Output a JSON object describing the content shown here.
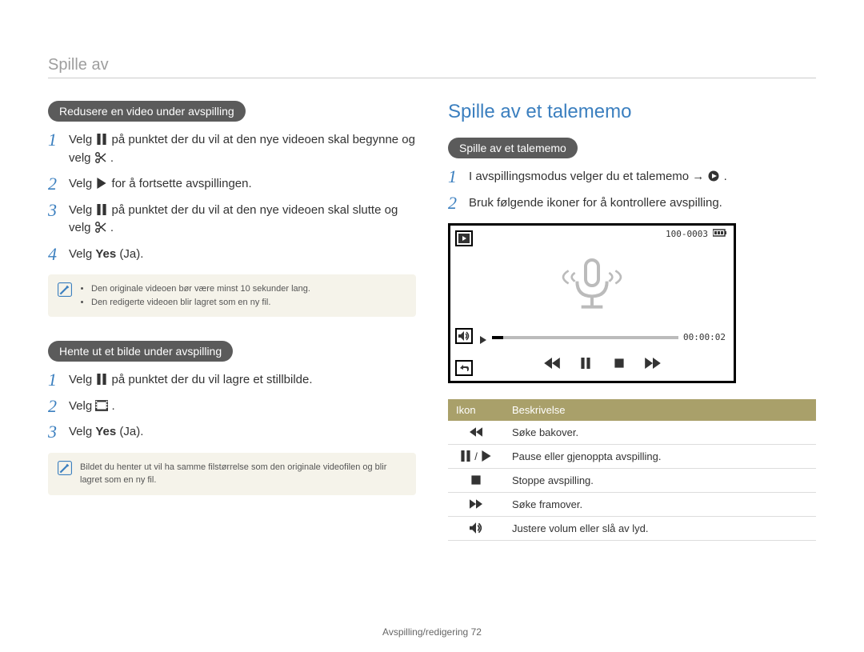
{
  "header": {
    "breadcrumb": "Spille av"
  },
  "left": {
    "sectionA": {
      "pill": "Redusere en video under avspilling",
      "steps": [
        {
          "n": "1",
          "pre": "Velg ",
          "mid": " på punktet der du vil at den nye videoen skal begynne og velg ",
          "post": "."
        },
        {
          "n": "2",
          "pre": "Velg ",
          "post": " for å fortsette avspillingen."
        },
        {
          "n": "3",
          "pre": "Velg ",
          "mid": " på punktet der du vil at den nye videoen skal slutte og velg ",
          "post": "."
        },
        {
          "n": "4",
          "pre": "Velg ",
          "bold": "Yes",
          "post": " (Ja)."
        }
      ],
      "note": [
        "Den originale videoen bør være minst 10 sekunder lang.",
        "Den redigerte videoen blir lagret som en ny fil."
      ]
    },
    "sectionB": {
      "pill": "Hente ut et bilde under avspilling",
      "steps": [
        {
          "n": "1",
          "pre": "Velg ",
          "post": " på punktet der du vil lagre et stillbilde."
        },
        {
          "n": "2",
          "pre": "Velg ",
          "post": "."
        },
        {
          "n": "3",
          "pre": "Velg ",
          "bold": "Yes",
          "post": " (Ja)."
        }
      ],
      "note": "Bildet du henter ut vil ha samme filstørrelse som den originale videofilen og blir lagret som en ny fil."
    }
  },
  "right": {
    "title": "Spille av et talememo",
    "pill": "Spille av et talememo",
    "steps": [
      {
        "n": "1",
        "pre": "I avspillingsmodus velger du et talememo → ",
        "post": "."
      },
      {
        "n": "2",
        "text": "Bruk følgende ikoner for å kontrollere avspilling."
      }
    ],
    "device": {
      "file_id": "100-0003",
      "time": "00:00:02"
    },
    "table": {
      "headers": {
        "icon": "Ikon",
        "desc": "Beskrivelse"
      },
      "rows": [
        {
          "icon": "rewind",
          "desc": "Søke bakover."
        },
        {
          "icon": "pause-play",
          "desc": "Pause eller gjenoppta avspilling."
        },
        {
          "icon": "stop",
          "desc": "Stoppe avspilling."
        },
        {
          "icon": "ffwd",
          "desc": "Søke framover."
        },
        {
          "icon": "volume",
          "desc": "Justere volum eller slå av lyd."
        }
      ]
    }
  },
  "footer": {
    "section": "Avspilling/redigering",
    "page": "72"
  }
}
